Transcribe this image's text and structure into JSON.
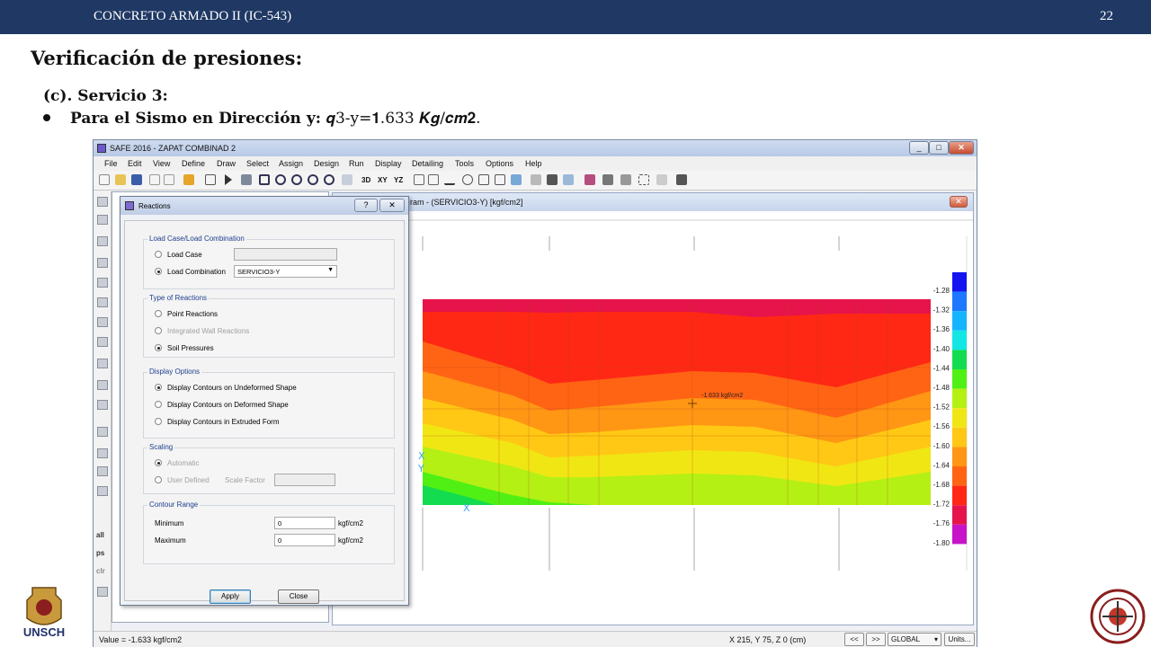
{
  "slide": {
    "course_title": "CONCRETO ARMADO II (IC-543)",
    "page_number": "22",
    "heading": "Verificación de presiones:",
    "subheading": "(c). Servicio 3:",
    "bullet_bold": "Para el Sismo en Dirección y:",
    "bullet_formula": "𝒒3-y=𝟏.633 𝑲𝒈/𝒄𝒎𝟐.",
    "logo_left_text": "UNSCH"
  },
  "app": {
    "title": "SAFE 2016 - ZAPAT COMBINAD 2",
    "window_buttons": [
      "_",
      "□",
      "✕"
    ],
    "menu": [
      "File",
      "Edit",
      "View",
      "Define",
      "Draw",
      "Select",
      "Assign",
      "Design",
      "Run",
      "Display",
      "Detailing",
      "Tools",
      "Options",
      "Help"
    ],
    "toolbar_text": [
      "3D",
      "XY",
      "YZ"
    ],
    "sidebar_text": [
      "all",
      "ps",
      "clr"
    ],
    "plot_window_title": "ram - (SERVICIO3-Y)  [kgf/cm2]",
    "plot_close": "✕",
    "annotation": "-1.633 kgf/cm2",
    "legend": [
      "-1.28",
      "-1.32",
      "-1.36",
      "-1.40",
      "-1.44",
      "-1.48",
      "-1.52",
      "-1.56",
      "-1.60",
      "-1.64",
      "-1.68",
      "-1.72",
      "-1.76",
      "-1.80"
    ],
    "legend_colors": [
      "#1414f0",
      "#1e78ff",
      "#14b4ff",
      "#14e6e6",
      "#14dc50",
      "#50f014",
      "#b4f014",
      "#f0e614",
      "#ffc814",
      "#ff9614",
      "#ff6414",
      "#ff2814",
      "#e6144b",
      "#c814c8"
    ],
    "status": {
      "value": "Value = -1.633 kgf/cm2",
      "coords": "X 215,  Y 75,  Z 0  (cm)",
      "prev": "<<",
      "next": ">>",
      "coord_system": "GLOBAL",
      "units": "Units..."
    }
  },
  "dialog": {
    "title": "Reactions",
    "help": "?",
    "close": "✕",
    "group_load": "Load Case/Load Combination",
    "load_case": "Load Case",
    "load_combination": "Load Combination",
    "load_combination_value": "SERVICIO3-Y",
    "group_type": "Type of Reactions",
    "point_reactions": "Point Reactions",
    "integrated_wall": "Integrated Wall Reactions",
    "soil_pressures": "Soil Pressures",
    "group_display": "Display Options",
    "disp_undeformed": "Display Contours on Undeformed Shape",
    "disp_deformed": "Display Contours on Deformed Shape",
    "disp_extruded": "Display Contours in Extruded Form",
    "group_scaling": "Scaling",
    "automatic": "Automatic",
    "user_defined": "User Defined",
    "scale_factor": "Scale Factor",
    "group_contour": "Contour Range",
    "minimum": "Minimum",
    "maximum": "Maximum",
    "min_value": "0",
    "max_value": "0",
    "unit": "kgf/cm2",
    "apply": "Apply",
    "close_btn": "Close"
  }
}
